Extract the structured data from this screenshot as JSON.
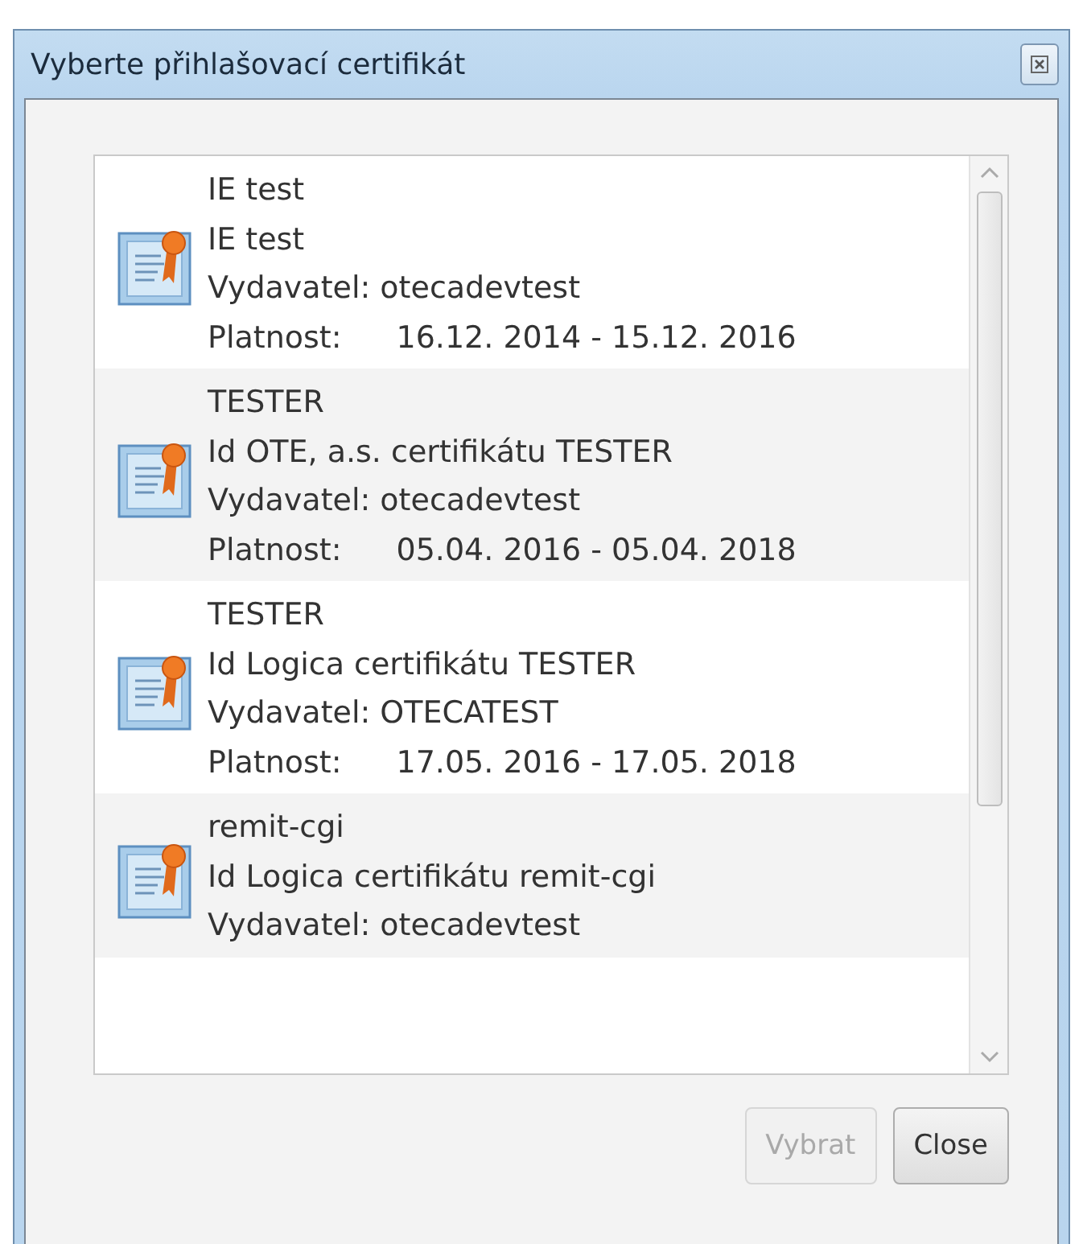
{
  "window": {
    "title": "Vyberte přihlašovací certifikát"
  },
  "certificates": [
    {
      "name": "IE test",
      "subject": "IE test",
      "issuer": "Vydavatel: otecadevtest",
      "validity_label": "Platnost:",
      "validity": "16.12. 2014 - 15.12. 2016",
      "selected": false
    },
    {
      "name": "TESTER",
      "subject": "Id OTE, a.s. certifikátu TESTER",
      "issuer": "Vydavatel: otecadevtest",
      "validity_label": "Platnost:",
      "validity": "05.04. 2016 - 05.04. 2018",
      "selected": false
    },
    {
      "name": "TESTER",
      "subject": "Id Logica certifikátu TESTER",
      "issuer": "Vydavatel: OTECATEST",
      "validity_label": "Platnost:",
      "validity": "17.05. 2016 - 17.05. 2018",
      "selected": false
    },
    {
      "name": "remit-cgi",
      "subject": "Id Logica certifikátu remit-cgi",
      "issuer": "Vydavatel: otecadevtest",
      "selected": false
    }
  ],
  "buttons": [
    {
      "label": "Vybrat",
      "disabled": true
    },
    {
      "label": "Close",
      "disabled": false
    }
  ]
}
